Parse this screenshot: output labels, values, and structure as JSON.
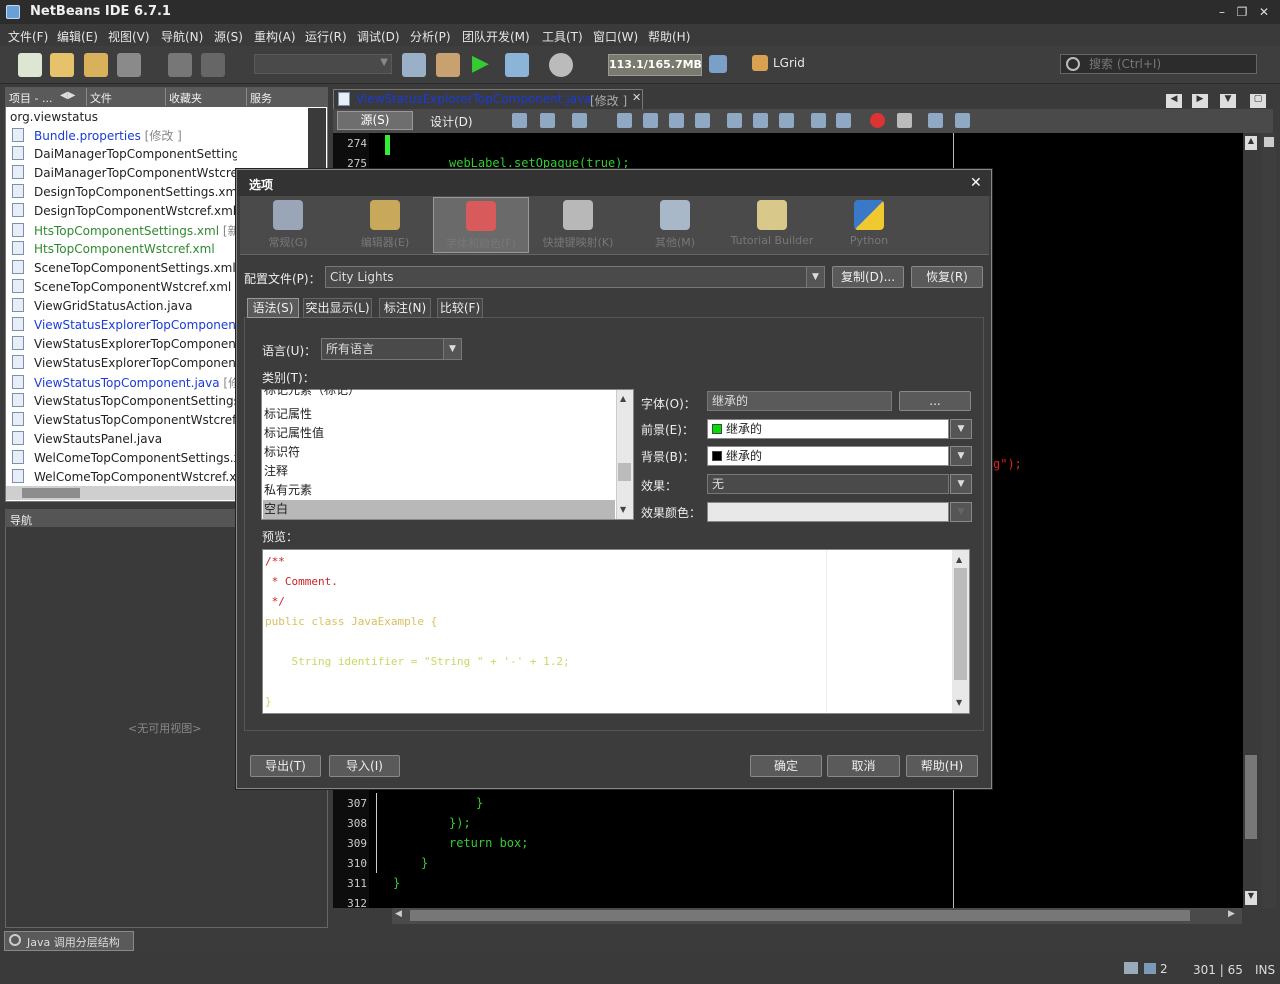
{
  "app": {
    "title": "NetBeans IDE 6.7.1"
  },
  "menu": [
    "文件(F)",
    "编辑(E)",
    "视图(V)",
    "导航(N)",
    "源(S)",
    "重构(A)",
    "运行(R)",
    "调试(D)",
    "分析(P)",
    "团队开发(M)",
    "工具(T)",
    "窗口(W)",
    "帮助(H)"
  ],
  "toolbar": {
    "memory": "113.1/165.7MB",
    "lgrid": "LGrid",
    "search_placeholder": "搜索 (Ctrl+I)"
  },
  "project_panel": {
    "tabs": [
      "项目 - ...",
      "文件",
      "收藏夹",
      "服务"
    ],
    "root": "org.viewstatus",
    "items": [
      {
        "label": "Bundle.properties",
        "badge": "[修改 ]",
        "style": "blue"
      },
      {
        "label": "DaiManagerTopComponentSettings.xml",
        "badge": "",
        "style": "normal"
      },
      {
        "label": "DaiManagerTopComponentWstcref.xml",
        "badge": "",
        "style": "normal"
      },
      {
        "label": "DesignTopComponentSettings.xml",
        "badge": "",
        "style": "normal"
      },
      {
        "label": "DesignTopComponentWstcref.xml",
        "badge": "",
        "style": "normal"
      },
      {
        "label": "HtsTopComponentSettings.xml",
        "badge": "[新",
        "style": "green"
      },
      {
        "label": "HtsTopComponentWstcref.xml",
        "badge": "",
        "style": "green"
      },
      {
        "label": "SceneTopComponentSettings.xml",
        "badge": "",
        "style": "normal"
      },
      {
        "label": "SceneTopComponentWstcref.xml",
        "badge": "",
        "style": "normal"
      },
      {
        "label": "ViewGridStatusAction.java",
        "badge": "",
        "style": "normal"
      },
      {
        "label": "ViewStatusExplorerTopComponent",
        "badge": "",
        "style": "blue"
      },
      {
        "label": "ViewStatusExplorerTopComponent",
        "badge": "",
        "style": "normal"
      },
      {
        "label": "ViewStatusExplorerTopComponent",
        "badge": "",
        "style": "normal"
      },
      {
        "label": "ViewStatusTopComponent.java",
        "badge": "[修",
        "style": "blue"
      },
      {
        "label": "ViewStatusTopComponentSettings",
        "badge": "",
        "style": "normal"
      },
      {
        "label": "ViewStatusTopComponentWstcref.",
        "badge": "",
        "style": "normal"
      },
      {
        "label": "ViewStautsPanel.java",
        "badge": "",
        "style": "normal"
      },
      {
        "label": "WelComeTopComponentSettings.x",
        "badge": "",
        "style": "normal"
      },
      {
        "label": "WelComeTopComponentWstcref.x",
        "badge": "",
        "style": "normal"
      }
    ]
  },
  "navigator": {
    "title": "导航",
    "empty": "<无可用视图>"
  },
  "editor": {
    "tab_label": "ViewStatusExplorerTopComponent.java",
    "tab_badge": "[修改 ]",
    "source_btn": "源(S)",
    "design_btn": "设计(D)",
    "lines_top": [
      {
        "n": "274",
        "code": ""
      },
      {
        "n": "275",
        "code": "webLabel.setOpaque(true);"
      }
    ],
    "lines_bottom": [
      {
        "n": "307",
        "code": "}"
      },
      {
        "n": "308",
        "code": "});"
      },
      {
        "n": "309",
        "code": "return box;"
      },
      {
        "n": "310",
        "code": "}"
      },
      {
        "n": "311",
        "code": "}"
      },
      {
        "n": "312",
        "code": ""
      }
    ],
    "red_fragment": "g\");"
  },
  "dialog": {
    "title": "选项",
    "categories": [
      "常规(G)",
      "编辑器(E)",
      "字体和颜色(F)",
      "快捷键映射(K)",
      "其他(M)",
      "Tutorial Builder",
      "Python"
    ],
    "profile_label": "配置文件(P)：",
    "profile_value": "City Lights",
    "duplicate_btn": "复制(D)...",
    "restore_btn": "恢复(R)",
    "subtabs": [
      "语法(S)",
      "突出显示(L)",
      "标注(N)",
      "比较(F)"
    ],
    "language_label": "语言(U)：",
    "language_value": "所有语言",
    "category_label": "类别(T)：",
    "category_items": [
      "标记元素（标记）",
      "标记属性",
      "标记属性值",
      "标识符",
      "注释",
      "私有元素",
      "空白"
    ],
    "font_label": "字体(O)：",
    "font_value": "继承的",
    "font_btn": "...",
    "fg_label": "前景(E)：",
    "fg_value": "继承的",
    "fg_color": "#00dd00",
    "bg_label": "背景(B)：",
    "bg_value": "继承的",
    "bg_color": "#000000",
    "effect_label": "效果：",
    "effect_value": "无",
    "effect_color_label": "效果颜色：",
    "preview_label": "预览：",
    "preview_lines": [
      "/**",
      " * Comment.",
      " */",
      "public class JavaExample {",
      "    String identifier = \"String \" + '-' + 1.2;",
      "}"
    ],
    "export_btn": "导出(T)",
    "import_btn": "导入(I)",
    "ok_btn": "确定",
    "cancel_btn": "取消",
    "help_btn": "帮助(H)"
  },
  "status": {
    "call_hierarchy": "Java 调用分层结构",
    "count": "2",
    "position": "301 | 65",
    "mode": "INS"
  },
  "colors": {
    "accent_blue": "#1a3bd8",
    "green": "#2f8a2f",
    "code_green": "#33cc33",
    "dialog_bg": "#3c3c3c"
  }
}
